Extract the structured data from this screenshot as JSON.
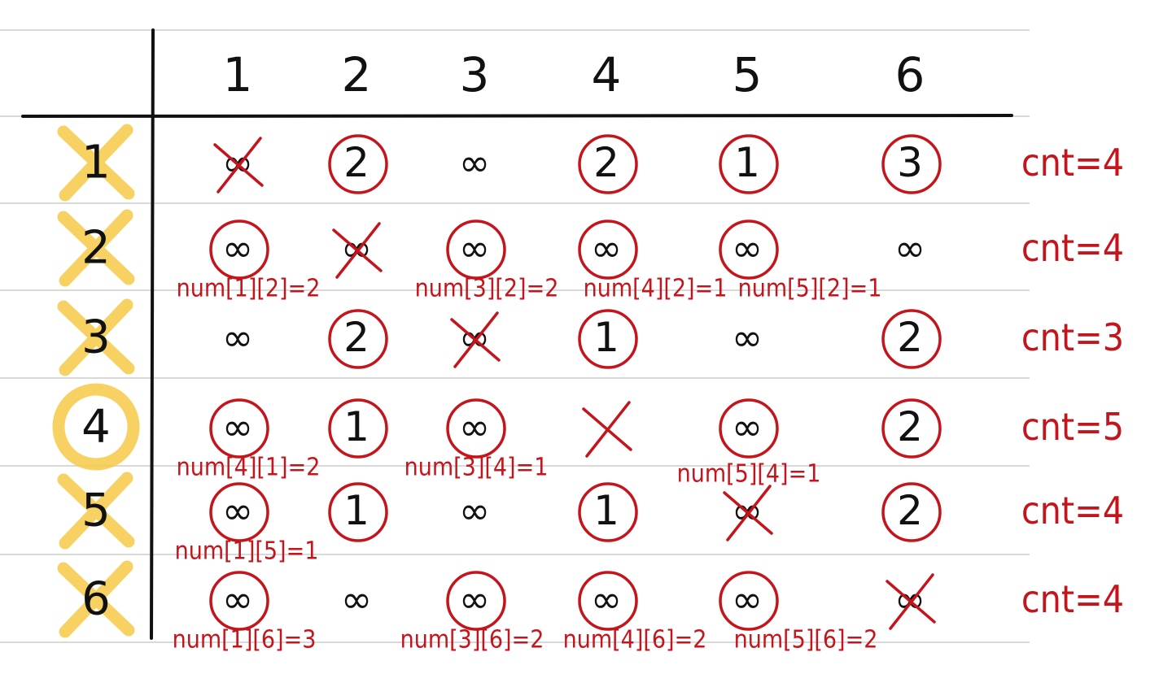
{
  "columns": [
    "1",
    "2",
    "3",
    "4",
    "5",
    "6"
  ],
  "rows": [
    {
      "label": "1",
      "row_mark": "cross",
      "cells": [
        "∞",
        "2",
        "∞",
        "2",
        "1",
        "3"
      ],
      "cell_marks": [
        "cross",
        "circle",
        "",
        "circle",
        "circle",
        "circle"
      ],
      "notes": [
        "",
        "",
        "",
        "",
        "",
        ""
      ],
      "count": "cnt=4"
    },
    {
      "label": "2",
      "row_mark": "cross",
      "cells": [
        "∞",
        "∞",
        "∞",
        "∞",
        "∞",
        "∞"
      ],
      "cell_marks": [
        "circle",
        "cross",
        "circle",
        "circle",
        "circle",
        ""
      ],
      "notes": [
        "num[1][2]=2",
        "",
        "num[3][2]=2",
        "num[4][2]=1",
        "num[5][2]=1",
        ""
      ],
      "count": "cnt=4"
    },
    {
      "label": "3",
      "row_mark": "cross",
      "cells": [
        "∞",
        "2",
        "∞",
        "1",
        "∞",
        "2"
      ],
      "cell_marks": [
        "",
        "circle",
        "cross",
        "circle",
        "",
        "circle"
      ],
      "notes": [
        "",
        "",
        "",
        "",
        "",
        ""
      ],
      "count": "cnt=3"
    },
    {
      "label": "4",
      "row_mark": "circle",
      "cells": [
        "∞",
        "1",
        "∞",
        "",
        "∞",
        "2"
      ],
      "cell_marks": [
        "circle",
        "circle",
        "circle",
        "cross",
        "circle",
        "circle"
      ],
      "notes": [
        "num[4][1]=2",
        "",
        "num[3][4]=1",
        "",
        "num[5][4]=1",
        ""
      ],
      "count": "cnt=5"
    },
    {
      "label": "5",
      "row_mark": "cross",
      "cells": [
        "∞",
        "1",
        "∞",
        "1",
        "∞",
        "2"
      ],
      "cell_marks": [
        "circle",
        "circle",
        "",
        "circle",
        "cross",
        "circle"
      ],
      "notes": [
        "num[1][5]=1",
        "",
        "",
        "",
        "",
        ""
      ],
      "count": "cnt=4"
    },
    {
      "label": "6",
      "row_mark": "cross",
      "cells": [
        "∞",
        "∞",
        "∞",
        "∞",
        "∞",
        "∞"
      ],
      "cell_marks": [
        "circle",
        "",
        "circle",
        "circle",
        "circle",
        "cross"
      ],
      "notes": [
        "num[1][6]=3",
        "",
        "num[3][6]=2",
        "num[4][6]=2",
        "num[5][6]=2",
        ""
      ],
      "count": "cnt=4"
    }
  ],
  "colors": {
    "ink": "#111111",
    "red_pen": "#c4151c",
    "highlighter": "#f7c948",
    "ruled_line": "#d9d9d9"
  }
}
